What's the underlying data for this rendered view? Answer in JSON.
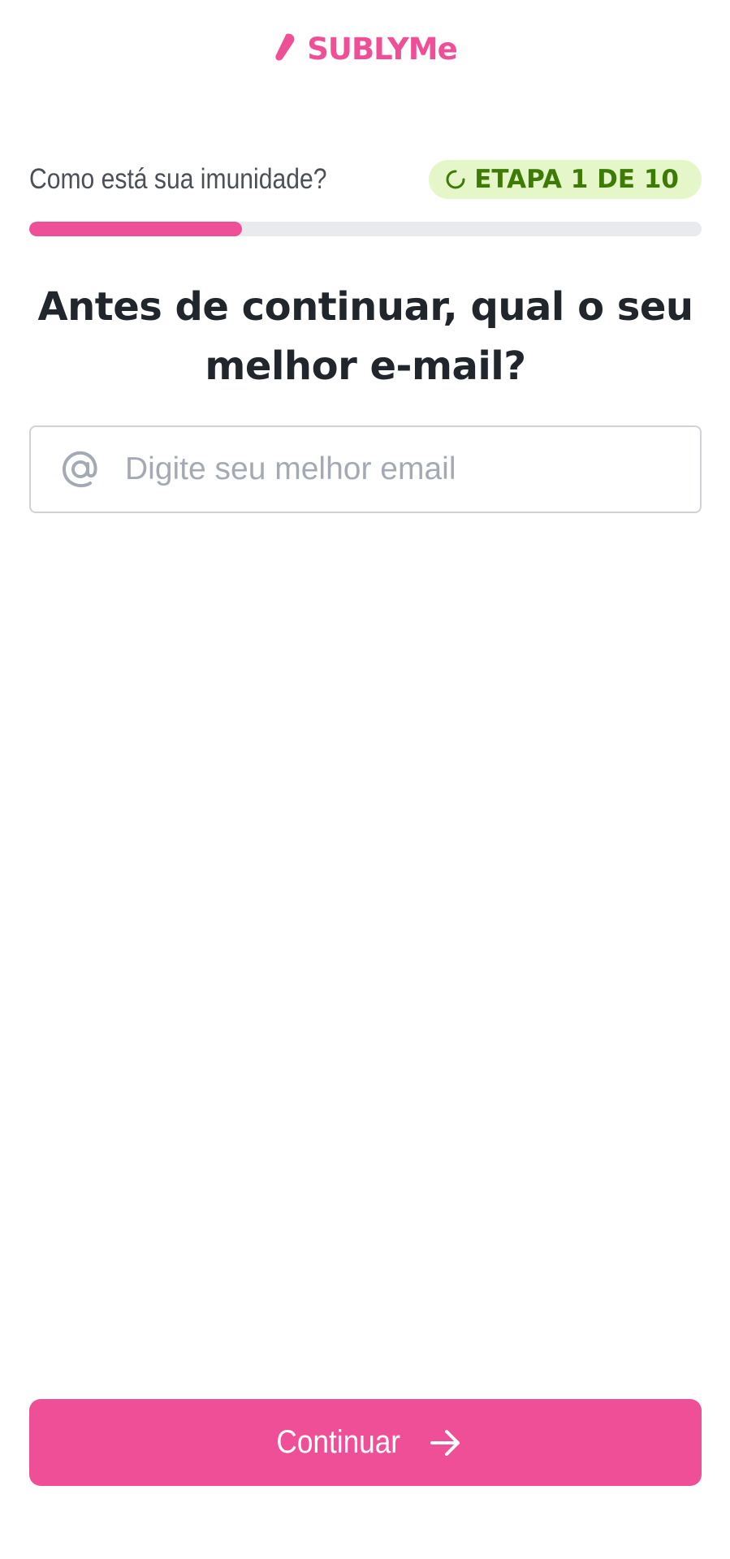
{
  "brand": {
    "name": "SUBLYMe",
    "color": "#ef4f97",
    "logo_icon": "leaf-pill-icon"
  },
  "header": {
    "quiz_title": "Como está sua imunidade?",
    "step_badge": "ETAPA 1 DE 10",
    "step_icon": "loading-spinner-icon",
    "badge_bg": "#e5f7c9",
    "badge_color": "#3e7a06"
  },
  "progress": {
    "fraction": 0.316,
    "color": "#ef4f97",
    "track_color": "#e8eaed"
  },
  "question": {
    "text": "Antes de continuar, qual o seu melhor e-mail?"
  },
  "email_field": {
    "placeholder": "Digite seu melhor email",
    "value": "",
    "icon": "at-sign-icon"
  },
  "continue_button": {
    "label": "Continuar",
    "icon": "arrow-right-icon",
    "bg_color": "#ef4f97"
  }
}
